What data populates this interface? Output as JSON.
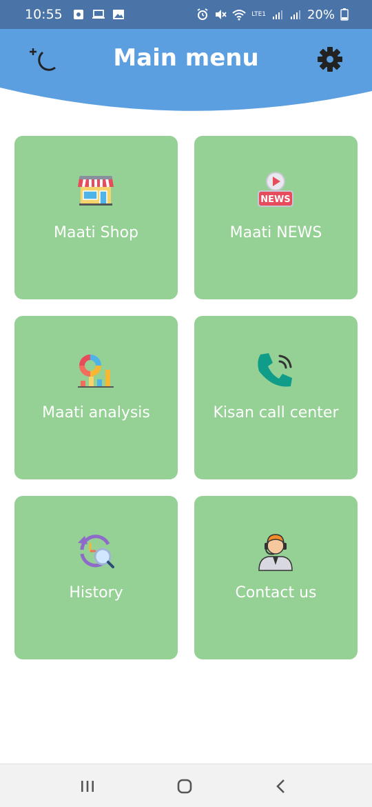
{
  "status_bar": {
    "time": "10:55",
    "battery": "20%",
    "left_icons": [
      "notification-icon",
      "laptop-icon",
      "image-icon"
    ],
    "right_icons": [
      "alarm-icon",
      "mute-icon",
      "wifi-icon",
      "volte-icon",
      "signal-icon",
      "signal-icon",
      "battery-icon"
    ],
    "lte_label": "LTE1"
  },
  "header": {
    "title": "Main menu",
    "accent_color": "#5b9fe0",
    "left_icon": "dark-mode-moon-icon",
    "right_icon": "settings-gear-icon"
  },
  "menu": {
    "card_color": "#95d095",
    "items": [
      {
        "label": "Maati Shop",
        "icon": "shop-icon"
      },
      {
        "label": "Maati NEWS",
        "icon": "news-icon"
      },
      {
        "label": "Maati analysis",
        "icon": "analysis-chart-icon"
      },
      {
        "label": "Kisan call center",
        "icon": "phone-call-icon"
      },
      {
        "label": "History",
        "icon": "history-icon"
      },
      {
        "label": "Contact us",
        "icon": "support-agent-icon"
      }
    ],
    "news_badge": "NEWS"
  },
  "nav_bar": {
    "buttons": [
      "recent-apps-icon",
      "home-icon",
      "back-icon"
    ]
  }
}
